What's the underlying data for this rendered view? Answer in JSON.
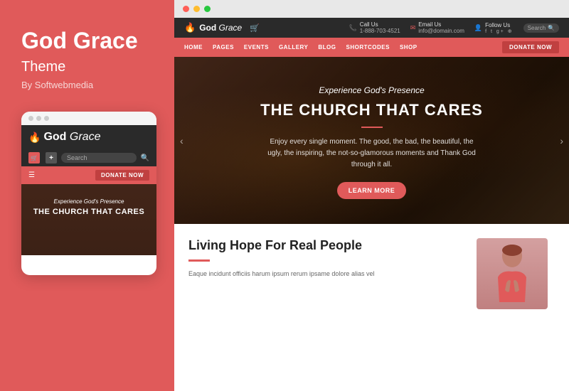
{
  "left": {
    "title": "God Grace",
    "subtitle": "Theme",
    "by": "By Softwebmedia",
    "dots": [
      "dot1",
      "dot2",
      "dot3"
    ],
    "mobile": {
      "logo_text": "God",
      "logo_italic": "Grace",
      "hero_sub": "Experience God's Presence",
      "hero_title": "THE CHURCH THAT CARES",
      "search_placeholder": "Search",
      "donate_label": "DONATE NOW",
      "hamburger": "☰"
    }
  },
  "right": {
    "browser_dots": [
      "red",
      "yellow",
      "green"
    ],
    "site": {
      "logo_text": "God",
      "logo_italic": "Grace",
      "nav_links": [
        "HOME",
        "PAGES",
        "EVENTS",
        "GALLERY",
        "BLOG",
        "SHORTCODES",
        "SHOP"
      ],
      "donate_label": "DONATE NOW",
      "contact_label": "Call Us",
      "contact_number": "1-888-703-4521",
      "email_label": "Email Us",
      "email_value": "info@domain.com",
      "follow_label": "Follow Us",
      "search_placeholder": "Search",
      "hero": {
        "sub": "Experience God's Presence",
        "title": "THE CHURCH THAT CARES",
        "desc": "Enjoy every single moment. The good, the bad, the beautiful, the ugly, the inspiring, the not-so-glamorous moments and Thank God through it all.",
        "btn_label": "LEARN MORE"
      },
      "bottom": {
        "title": "Living Hope For Real People",
        "desc": "Eaque incidunt officiis harum ipsum rerum ipsame dolore alias vel"
      }
    }
  }
}
